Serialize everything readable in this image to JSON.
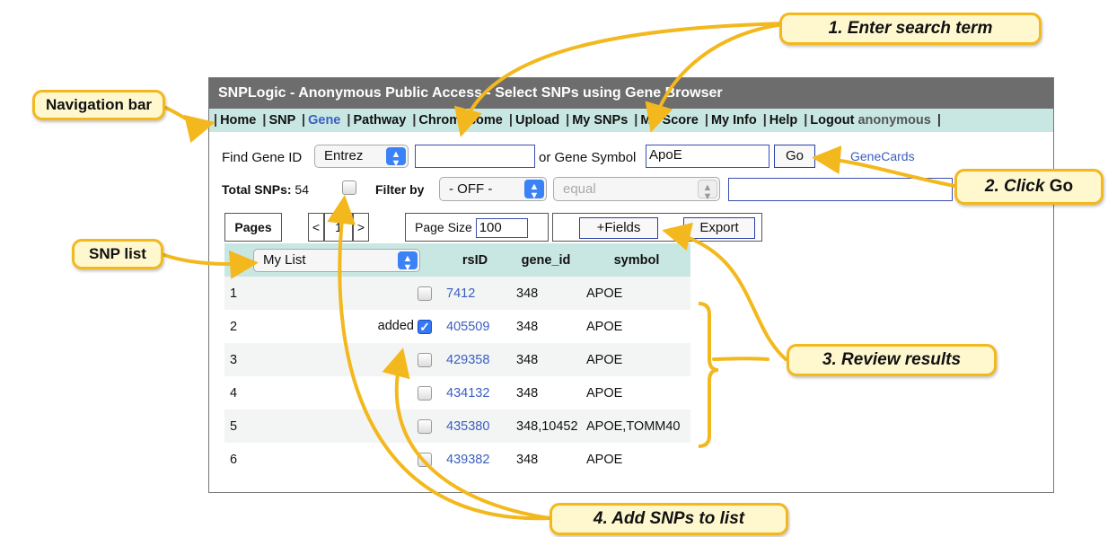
{
  "window": {
    "title": "SNPLogic - Anonymous Public Access - Select SNPs using Gene Browser"
  },
  "nav": {
    "items": [
      "Home",
      "SNP",
      "Gene",
      "Pathway",
      "Chromosome",
      "Upload",
      "My SNPs",
      "My Score",
      "My Info",
      "Help"
    ],
    "active": "Gene",
    "logout_label": "Logout",
    "user": "anonymous"
  },
  "search": {
    "find_label": "Find Gene ID",
    "id_source": "Entrez",
    "id_value": "",
    "symbol_label": "or Gene Symbol",
    "symbol_value": "ApoE",
    "go_label": "Go",
    "genecards_label": "GeneCards"
  },
  "filter": {
    "total_label": "Total SNPs:",
    "total_value": "54",
    "filter_label": "Filter by",
    "filter_value": "- OFF -",
    "op_value": "equal",
    "value": ""
  },
  "pager": {
    "pages_label": "Pages",
    "prev": "<",
    "current": "1",
    "next": ">",
    "page_size_label": "Page Size",
    "page_size_value": "100",
    "fields_label": "+Fields",
    "export_label": "Export"
  },
  "table": {
    "hash_header": "#",
    "list_select": "My List",
    "headers": [
      "rsID",
      "gene_id",
      "symbol"
    ],
    "rows": [
      {
        "n": "1",
        "status": "",
        "checked": false,
        "rsid": "7412",
        "gene_id": "348",
        "symbol": "APOE"
      },
      {
        "n": "2",
        "status": "added",
        "checked": true,
        "rsid": "405509",
        "gene_id": "348",
        "symbol": "APOE"
      },
      {
        "n": "3",
        "status": "",
        "checked": false,
        "rsid": "429358",
        "gene_id": "348",
        "symbol": "APOE"
      },
      {
        "n": "4",
        "status": "",
        "checked": false,
        "rsid": "434132",
        "gene_id": "348",
        "symbol": "APOE"
      },
      {
        "n": "5",
        "status": "",
        "checked": false,
        "rsid": "435380",
        "gene_id": "348,10452",
        "symbol": "APOE,TOMM40"
      },
      {
        "n": "6",
        "status": "",
        "checked": false,
        "rsid": "439382",
        "gene_id": "348",
        "symbol": "APOE"
      }
    ]
  },
  "callouts": {
    "step1": "1. Enter search term",
    "step2_text": "2. Click",
    "step2_go": "Go",
    "step3": "3. Review results",
    "step4": "4. Add SNPs to list",
    "nav_bar": "Navigation bar",
    "snp_list": "SNP list"
  },
  "colors": {
    "accent_teal": "#c9e7e2",
    "link_blue": "#3a5ec0",
    "callout_border": "#f3b81d",
    "callout_fill": "#fff8cf",
    "titlebar_gray": "#6d6d6d"
  }
}
